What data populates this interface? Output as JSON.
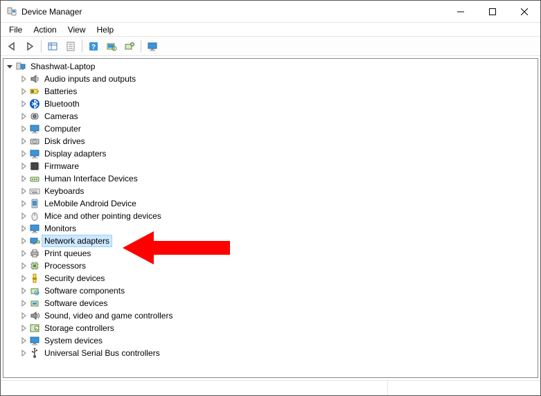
{
  "titlebar": {
    "title": "Device Manager"
  },
  "menubar": {
    "items": [
      "File",
      "Action",
      "View",
      "Help"
    ]
  },
  "toolbar": {
    "buttons": [
      {
        "name": "back-button",
        "icon": "arrow-left-icon"
      },
      {
        "name": "forward-button",
        "icon": "arrow-right-icon"
      },
      {
        "sep": true
      },
      {
        "name": "show-hide-tree-button",
        "icon": "panel-icon"
      },
      {
        "name": "properties-button",
        "icon": "properties-icon"
      },
      {
        "sep": true
      },
      {
        "name": "help-button",
        "icon": "help-icon"
      },
      {
        "name": "scan-hardware-button",
        "icon": "scan-icon"
      },
      {
        "name": "add-hardware-button",
        "icon": "add-hw-icon"
      },
      {
        "sep": true
      },
      {
        "name": "monitor-button",
        "icon": "monitor-icon"
      }
    ]
  },
  "tree": {
    "root": {
      "label": "Shashwat-Laptop",
      "expanded": true,
      "children": [
        {
          "label": "Audio inputs and outputs",
          "icon": "speaker-icon"
        },
        {
          "label": "Batteries",
          "icon": "battery-icon"
        },
        {
          "label": "Bluetooth",
          "icon": "bluetooth-icon"
        },
        {
          "label": "Cameras",
          "icon": "camera-icon"
        },
        {
          "label": "Computer",
          "icon": "computer-icon"
        },
        {
          "label": "Disk drives",
          "icon": "disk-icon"
        },
        {
          "label": "Display adapters",
          "icon": "display-icon"
        },
        {
          "label": "Firmware",
          "icon": "firmware-icon"
        },
        {
          "label": "Human Interface Devices",
          "icon": "hid-icon"
        },
        {
          "label": "Keyboards",
          "icon": "keyboard-icon"
        },
        {
          "label": "LeMobile Android Device",
          "icon": "android-icon"
        },
        {
          "label": "Mice and other pointing devices",
          "icon": "mouse-icon"
        },
        {
          "label": "Monitors",
          "icon": "monitor-icon"
        },
        {
          "label": "Network adapters",
          "icon": "network-icon",
          "selected": true
        },
        {
          "label": "Print queues",
          "icon": "printer-icon"
        },
        {
          "label": "Processors",
          "icon": "cpu-icon"
        },
        {
          "label": "Security devices",
          "icon": "security-icon"
        },
        {
          "label": "Software components",
          "icon": "component-icon"
        },
        {
          "label": "Software devices",
          "icon": "softdev-icon"
        },
        {
          "label": "Sound, video and game controllers",
          "icon": "sound-icon"
        },
        {
          "label": "Storage controllers",
          "icon": "storage-icon"
        },
        {
          "label": "System devices",
          "icon": "system-icon"
        },
        {
          "label": "Universal Serial Bus controllers",
          "icon": "usb-icon"
        }
      ]
    }
  }
}
